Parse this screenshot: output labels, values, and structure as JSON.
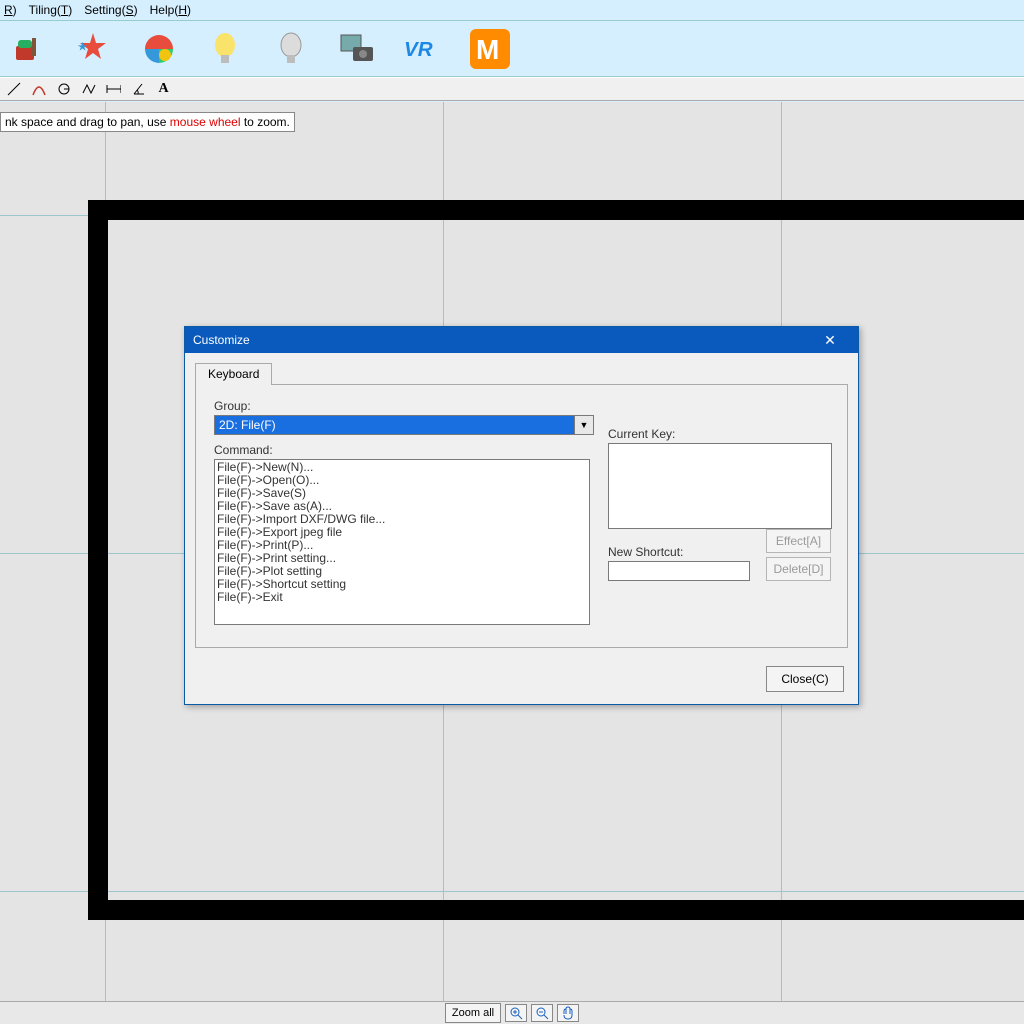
{
  "menu": {
    "items": [
      "R)",
      "Tiling(T)",
      "Setting(S)",
      "Help(H)"
    ]
  },
  "hint": {
    "pre": "nk space and drag to pan, use ",
    "hl": "mouse wheel",
    "post": " to zoom."
  },
  "status": {
    "zoom": "Zoom all"
  },
  "dialog": {
    "title": "Customize",
    "tab": "Keyboard",
    "groupLabel": "Group:",
    "groupValue": "2D: File(F)",
    "commandLabel": "Command:",
    "commands": [
      "File(F)->New(N)...",
      "File(F)->Open(O)...",
      "File(F)->Save(S)",
      "File(F)->Save as(A)...",
      "File(F)->Import DXF/DWG file...",
      "File(F)->Export jpeg file",
      "File(F)->Print(P)...",
      "File(F)->Print setting...",
      "File(F)->Plot setting",
      "File(F)->Shortcut setting",
      "File(F)->Exit"
    ],
    "currentKeyLabel": "Current Key:",
    "newShortcutLabel": "New Shortcut:",
    "effectBtn": "Effect[A]",
    "deleteBtn": "Delete[D]",
    "closeBtn": "Close(C)"
  }
}
